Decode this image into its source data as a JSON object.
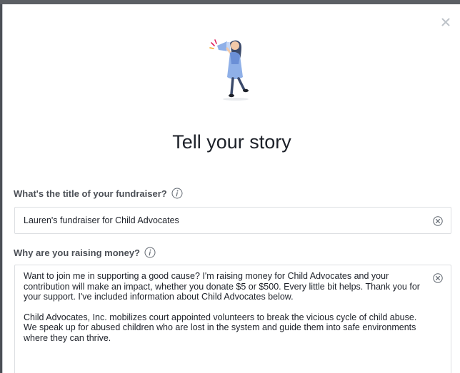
{
  "dialog": {
    "title": "Tell your story",
    "close_icon": "close-icon"
  },
  "fields": {
    "fundraiser_title": {
      "label": "What's the title of your fundraiser?",
      "value": "Lauren's fundraiser for Child Advocates",
      "info_icon": "info-icon",
      "clear_icon": "clear-icon"
    },
    "reason": {
      "label": "Why are you raising money?",
      "paragraphs": [
        "Want to join me in supporting a good cause? I'm raising money for Child Advocates and your contribution will make an impact, whether you donate $5 or $500. Every little bit helps. Thank you for your support. I've included information about Child Advocates below.",
        "Child Advocates, Inc. mobilizes court appointed volunteers to break the vicious cycle of child abuse. We speak up for abused children who are lost in the system and guide them into safe environments where they can thrive."
      ],
      "info_icon": "info-icon",
      "clear_icon": "clear-icon"
    }
  },
  "colors": {
    "backdrop": "#4b4f56",
    "border": "#dddfe2",
    "label": "#4b4f56",
    "illustration_blue": "#8fb0e8",
    "illustration_dark": "#3b4a6b"
  }
}
